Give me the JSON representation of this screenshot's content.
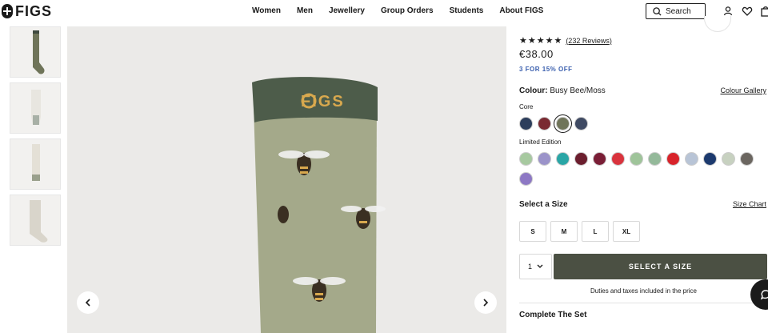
{
  "header": {
    "logo_text": "FIGS",
    "nav": [
      "Women",
      "Men",
      "Jewellery",
      "Group Orders",
      "Students",
      "About FIGS"
    ],
    "search_label": "Search"
  },
  "product": {
    "rating_stars": "★★★★★",
    "review_count": "(232 Reviews)",
    "price": "€38.00",
    "promo": "3 FOR 15% OFF",
    "colour_label": "Colour:",
    "colour_value": "Busy Bee/Moss",
    "colour_gallery": "Colour Gallery",
    "core_label": "Core",
    "limited_label": "Limited Edition",
    "select_size": "Select a Size",
    "size_chart": "Size Chart",
    "sizes": [
      "S",
      "M",
      "L",
      "XL"
    ],
    "quantity": "1",
    "add_button": "SELECT A SIZE",
    "duties": "Duties and taxes included in the price",
    "complete_set": "Complete The Set",
    "sock_logo": "FIGS"
  },
  "colors": {
    "core": [
      "#2c3e5c",
      "#7a2a32",
      "#6f7459",
      "#3f4a63"
    ],
    "limited": [
      "#a7c9a0",
      "#9b93c9",
      "#2aa6a6",
      "#6b1e2e",
      "#7a1e36",
      "#d9333d",
      "#9fc49a",
      "#94b99a",
      "#d8232a",
      "#b8c4d6",
      "#1c3a6e",
      "#c7d1c0",
      "#6b6660",
      "#8d78c4"
    ],
    "accent_button": "#4b5043",
    "promo_text": "#3a5fae"
  }
}
